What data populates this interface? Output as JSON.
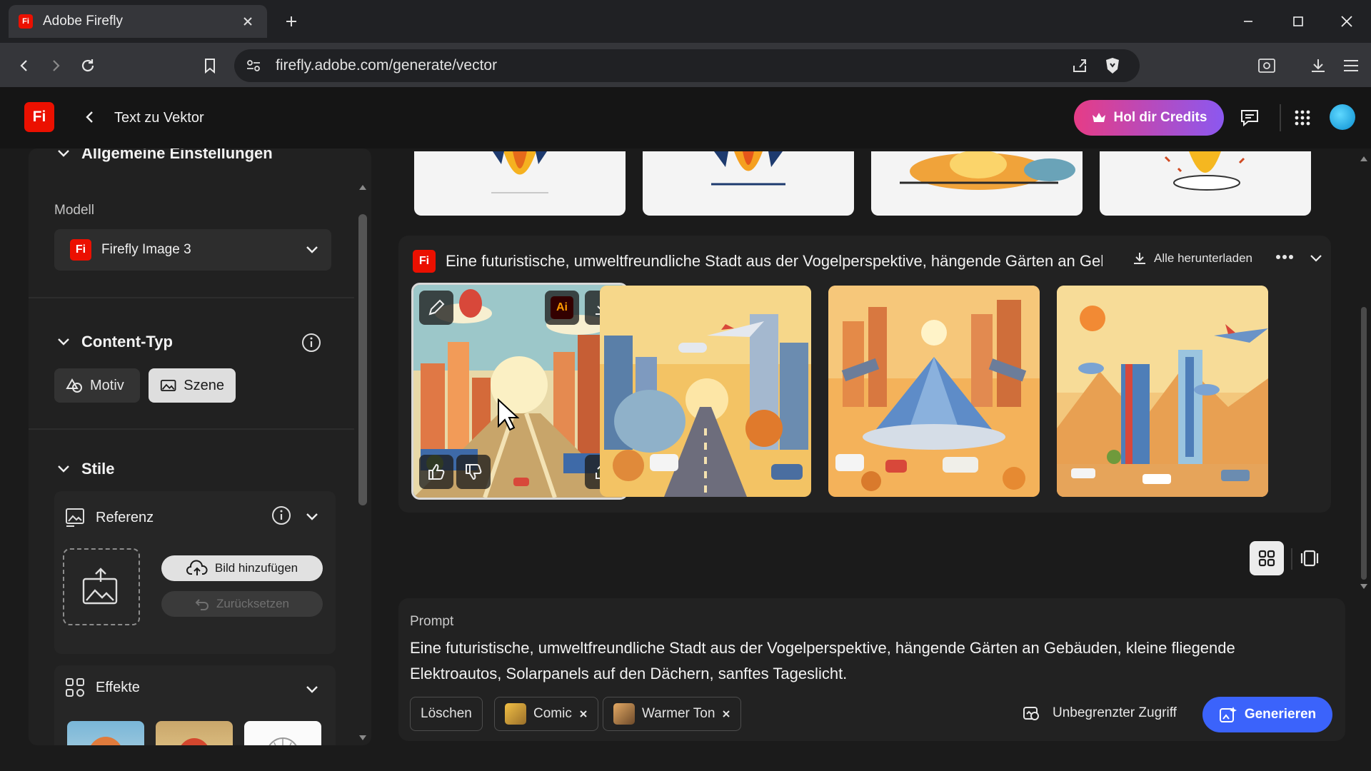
{
  "browser": {
    "tab_title": "Adobe Firefly",
    "tab_favicon": "Fi",
    "url": "firefly.adobe.com/generate/vector"
  },
  "header": {
    "logo": "Fi",
    "title": "Text zu Vektor",
    "credits_label": "Hol dir Credits"
  },
  "sidebar": {
    "general": {
      "heading": "Allgemeine Einstellungen",
      "model_label": "Modell",
      "model_value": "Firefly Image 3",
      "model_icon": "Fi"
    },
    "content_type": {
      "heading": "Content-Typ",
      "options": [
        "Motiv",
        "Szene"
      ],
      "selected": "Szene"
    },
    "styles": {
      "heading": "Stile",
      "reference": {
        "label": "Referenz",
        "add_image": "Bild hinzufügen",
        "reset": "Zurücksetzen"
      },
      "effects": {
        "label": "Effekte"
      }
    }
  },
  "results": {
    "group_icon": "Fi",
    "group_title": "Eine futuristische, umweltfreundliche Stadt aus der Vogelperspektive, hängende Gärten an Gebäuden, kleine fliegende Elektroautos, Solarpanels auf den Dächern, sanftes Tageslicht.",
    "download_all": "Alle herunterladen",
    "edit_badge": "Ai"
  },
  "prompt": {
    "label": "Prompt",
    "text": "Eine futuristische, umweltfreundliche Stadt aus der Vogelperspektive, hängende Gärten an Gebäuden, kleine fliegende Elektroautos, Solarpanels auf den Dächern, sanftes Tageslicht.",
    "clear": "Löschen",
    "chips": [
      "Comic",
      "Warmer Ton"
    ],
    "unlimited": "Unbegrenzter Zugriff",
    "generate": "Generieren"
  },
  "colors": {
    "adobe_red": "#eb1000",
    "accent_blue": "#3b63fb",
    "credits_from": "#e63c86",
    "credits_to": "#8b58f0"
  }
}
